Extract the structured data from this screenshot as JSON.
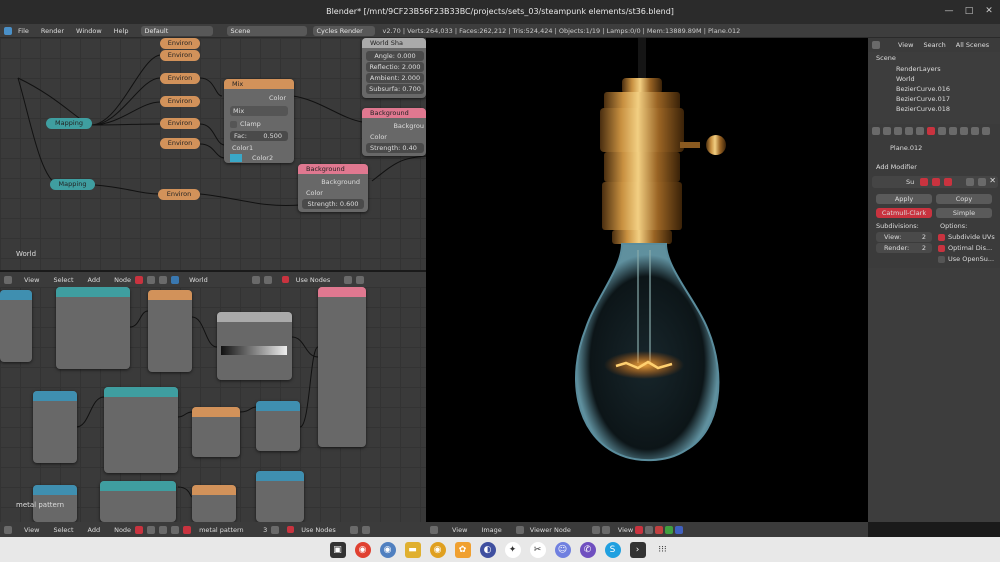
{
  "window": {
    "title": "Blender* [/mnt/9CF23B56F23B33BC/projects/sets_03/steampunk elements/st36.blend]"
  },
  "info_header": {
    "menus": [
      "File",
      "Render",
      "Window",
      "Help"
    ],
    "layout": "Default",
    "scene": "Scene",
    "engine": "Cycles Render",
    "stats": "v2.70 | Verts:264,033 | Faces:262,212 | Tris:524,424 | Objects:1/19 | Lamps:0/0 | Mem:13889.89M | Plane.012"
  },
  "world_node_editor": {
    "label": "World",
    "nodes": {
      "environ_labels": [
        "Environ",
        "Environ",
        "Environ",
        "Environ",
        "Environ",
        "Environ"
      ],
      "mapping_labels": [
        "Mapping",
        "Mapping"
      ],
      "mix": {
        "title": "Mix",
        "out": "Color",
        "mode": "Mix",
        "clamp": "Clamp",
        "fac_label": "Fac:",
        "fac_value": "0.500",
        "color1": "Color1",
        "color2": "Color2"
      },
      "background1": {
        "title": "Background",
        "out": "Backgrou",
        "color": "Color",
        "strength": "Strength: 0.40"
      },
      "background2": {
        "title": "Background",
        "out": "Background",
        "color": "Color",
        "strength": "Strength: 0.600"
      },
      "world_output": {
        "title": "World Sha",
        "rows": [
          "Angle: 0.000",
          "Reflectio: 2.000",
          "Ambient: 2.000",
          "Subsurfa: 0.700"
        ]
      }
    }
  },
  "material_node_editor": {
    "header_menus": [
      "View",
      "Select",
      "Add",
      "Node"
    ],
    "header_world": "World",
    "use_nodes": "Use Nodes",
    "bottom_menus": [
      "View",
      "Select",
      "Add",
      "Node"
    ],
    "material_name": "metal pattern",
    "users": "3",
    "bottom_use_nodes": "Use Nodes",
    "corner_label": "metal pattern"
  },
  "viewport": {
    "header_menus": [
      "View",
      "Image"
    ],
    "viewer_node": "Viewer Node",
    "view_label": "View"
  },
  "outliner": {
    "menus": [
      "View",
      "Search",
      "All Scenes"
    ],
    "items": [
      "Scene",
      "RenderLayers",
      "World",
      "BezierCurve.016",
      "BezierCurve.017",
      "BezierCurve.018"
    ]
  },
  "properties": {
    "object_name": "Plane.012",
    "add_modifier": "Add Modifier",
    "modifier_name": "Su",
    "apply": "Apply",
    "copy": "Copy",
    "catmull": "Catmull-Clark",
    "simple": "Simple",
    "subdivisions": "Subdivisions:",
    "view_label": "View:",
    "view_value": "2",
    "render_label": "Render:",
    "render_value": "2",
    "options": "Options:",
    "subdivide_uvs": "Subdivide UVs",
    "optimal_display": "Optimal Dis...",
    "use_opensubdiv": "Use OpenSu..."
  },
  "colors": {
    "node_orange": "#d2925a",
    "node_teal": "#3f9ea0",
    "node_pink": "#e07890",
    "accent_red": "#c9333f",
    "socket_yellow": "#d8c838",
    "socket_blue": "#7878e0",
    "socket_gray": "#a0a0a0",
    "socket_green": "#60c060"
  },
  "taskbar": {
    "icons": [
      "terminal-icon",
      "chrome-icon",
      "chromium-icon",
      "files-icon",
      "chrome-canary-icon",
      "photos-icon",
      "blender-icon",
      "inkscape-icon",
      "scissors-icon",
      "discord-icon",
      "viber-icon",
      "skype-icon",
      "shell-icon",
      "apps-grid-icon"
    ]
  }
}
